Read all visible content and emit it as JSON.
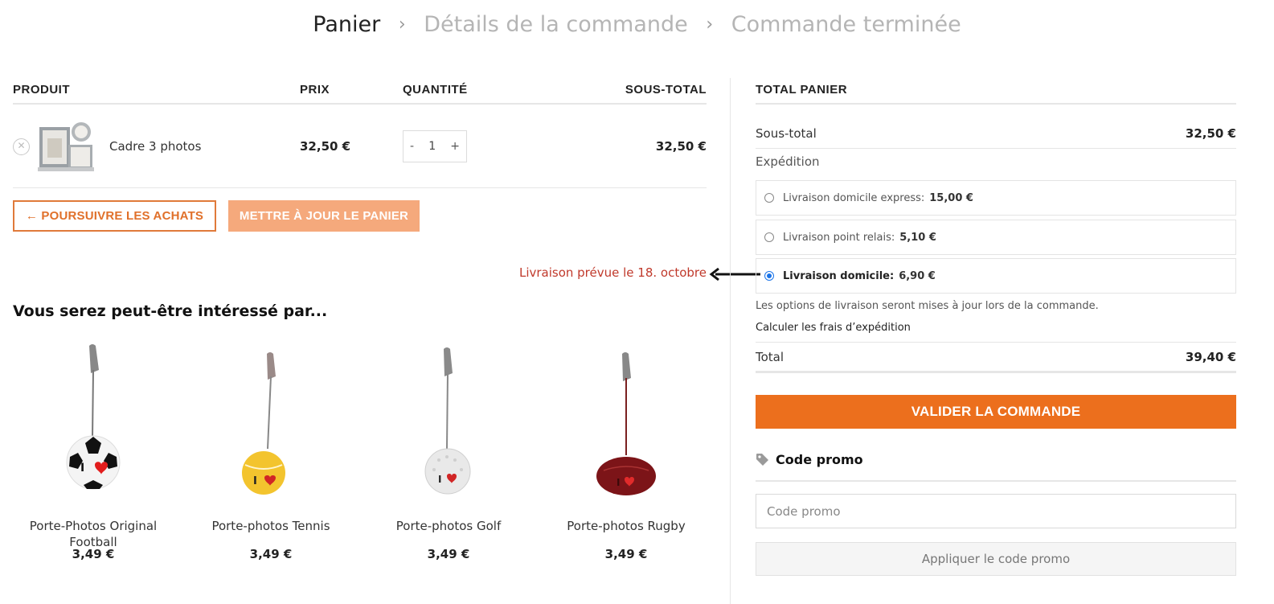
{
  "breadcrumb": {
    "step1": "Panier",
    "step2": "Détails de la commande",
    "step3": "Commande terminée"
  },
  "cart": {
    "headers": {
      "product": "PRODUIT",
      "price": "PRIX",
      "quantity": "QUANTITÉ",
      "subtotal": "SOUS-TOTAL"
    },
    "item": {
      "remove_icon": "close-circle-icon",
      "name": "Cadre 3 photos",
      "price": "32,50 €",
      "qty_minus": "-",
      "qty_value": "1",
      "qty_plus": "+",
      "subtotal": "32,50 €"
    },
    "continue_label": "← POURSUIVRE LES ACHATS",
    "update_label": "METTRE À JOUR LE PANIER",
    "delivery_note": "Livraison prévue le 18. octobre"
  },
  "suggestions": {
    "title": "Vous serez peut-être intéressé par...",
    "items": [
      {
        "name": "Porte-Photos Original Football",
        "price": "3,49 €"
      },
      {
        "name": "Porte-photos Tennis",
        "price": "3,49 €"
      },
      {
        "name": "Porte-photos Golf",
        "price": "3,49 €"
      },
      {
        "name": "Porte-photos Rugby",
        "price": "3,49 €"
      }
    ]
  },
  "totals": {
    "title": "TOTAL PANIER",
    "subtotal_label": "Sous-total",
    "subtotal_value": "32,50 €",
    "shipping_label": "Expédition",
    "shipping_options": [
      {
        "label": "Livraison domicile express:",
        "price": "15,00 €",
        "selected": false
      },
      {
        "label": "Livraison point relais:",
        "price": "5,10 €",
        "selected": false
      },
      {
        "label": "Livraison domicile:",
        "price": "6,90 €",
        "selected": true
      }
    ],
    "shipping_note": "Les options de livraison seront mises à jour lors de la commande.",
    "calc_link": "Calculer les frais d’expédition",
    "total_label": "Total",
    "total_value": "39,40 €",
    "checkout_label": "VALIDER LA COMMANDE"
  },
  "promo": {
    "heading": "Code promo",
    "icon": "tag-icon",
    "placeholder": "Code promo",
    "apply_label": "Appliquer le code promo"
  },
  "colors": {
    "accent": "#ec6f1d",
    "accent_light": "#f5a97c",
    "delivery_note": "#c0392b"
  }
}
